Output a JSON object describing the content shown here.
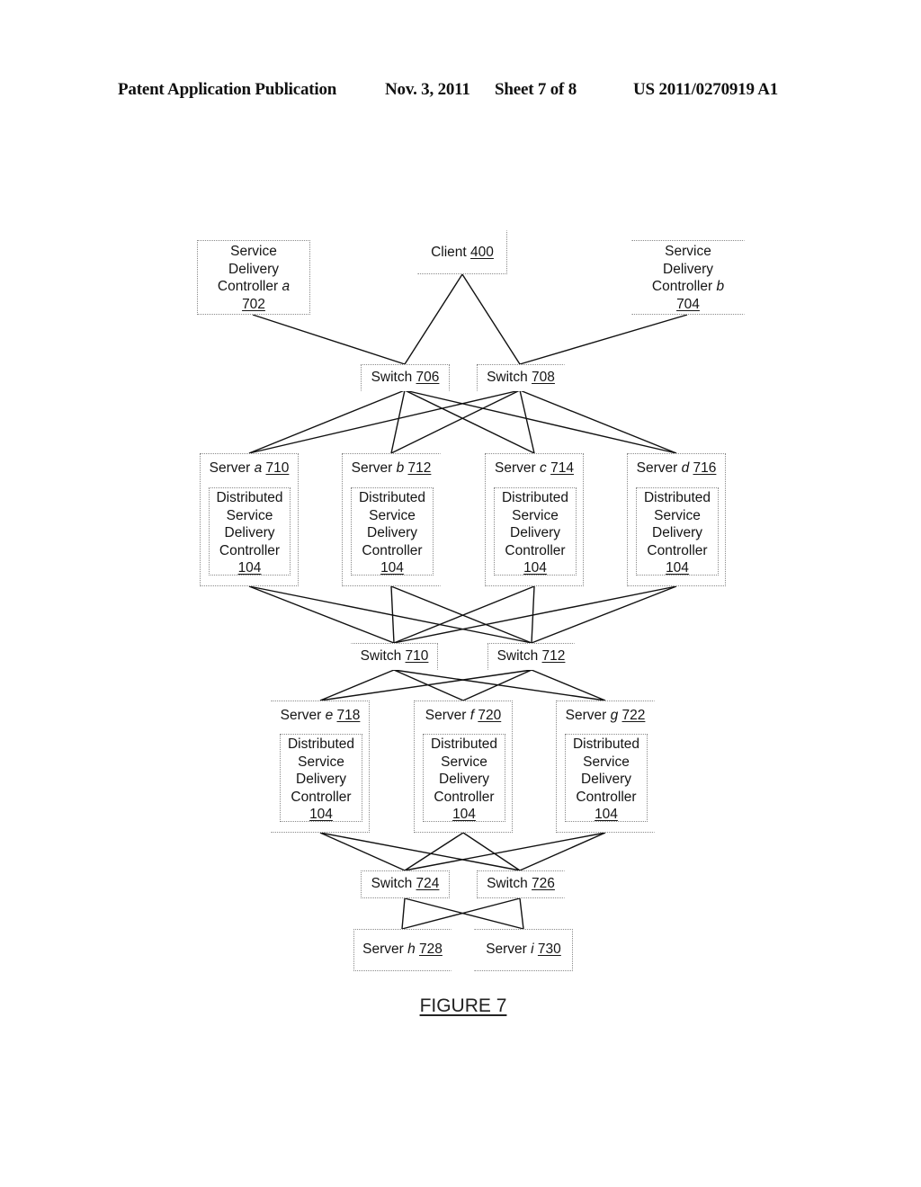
{
  "header": {
    "publication": "Patent Application Publication",
    "date": "Nov. 3, 2011",
    "sheet": "Sheet 7 of 8",
    "number": "US 2011/0270919 A1"
  },
  "figure_caption": "FIGURE 7",
  "nodes": {
    "sdc_a": {
      "l1": "Service",
      "l2": "Delivery",
      "l3": "Controller",
      "var": "a",
      "ref": "702"
    },
    "client": {
      "label": "Client",
      "ref": "400"
    },
    "sdc_b": {
      "l1": "Service",
      "l2": "Delivery",
      "l3": "Controller",
      "var": "b",
      "ref": "704"
    },
    "sw706": {
      "label": "Switch",
      "ref": "706"
    },
    "sw708": {
      "label": "Switch",
      "ref": "708"
    },
    "sw710": {
      "label": "Switch",
      "ref": "710"
    },
    "sw712": {
      "label": "Switch",
      "ref": "712"
    },
    "sw724": {
      "label": "Switch",
      "ref": "724"
    },
    "sw726": {
      "label": "Switch",
      "ref": "726"
    },
    "srv_a": {
      "label": "Server",
      "var": "a",
      "ref": "710"
    },
    "srv_b": {
      "label": "Server",
      "var": "b",
      "ref": "712"
    },
    "srv_c": {
      "label": "Server",
      "var": "c",
      "ref": "714"
    },
    "srv_d": {
      "label": "Server",
      "var": "d",
      "ref": "716"
    },
    "srv_e": {
      "label": "Server",
      "var": "e",
      "ref": "718"
    },
    "srv_f": {
      "label": "Server",
      "var": "f",
      "ref": "720"
    },
    "srv_g": {
      "label": "Server",
      "var": "g",
      "ref": "722"
    },
    "srv_h": {
      "label": "Server",
      "var": "h",
      "ref": "728"
    },
    "srv_i": {
      "label": "Server",
      "var": "i",
      "ref": "730"
    }
  },
  "dsdc": {
    "l1": "Distributed",
    "l2": "Service",
    "l3": "Delivery",
    "l4": "Controller",
    "ref": "104"
  },
  "edges": [
    [
      "sdc_a",
      "sw706"
    ],
    [
      "client",
      "sw706"
    ],
    [
      "client",
      "sw708"
    ],
    [
      "sdc_b",
      "sw708"
    ],
    [
      "sw706",
      "srv_a"
    ],
    [
      "sw706",
      "srv_b"
    ],
    [
      "sw706",
      "srv_c"
    ],
    [
      "sw706",
      "srv_d"
    ],
    [
      "sw708",
      "srv_a"
    ],
    [
      "sw708",
      "srv_b"
    ],
    [
      "sw708",
      "srv_c"
    ],
    [
      "sw708",
      "srv_d"
    ],
    [
      "srv_a",
      "sw710"
    ],
    [
      "srv_b",
      "sw710"
    ],
    [
      "srv_c",
      "sw710"
    ],
    [
      "srv_d",
      "sw710"
    ],
    [
      "srv_a",
      "sw712"
    ],
    [
      "srv_b",
      "sw712"
    ],
    [
      "srv_c",
      "sw712"
    ],
    [
      "srv_d",
      "sw712"
    ],
    [
      "sw710",
      "srv_e"
    ],
    [
      "sw710",
      "srv_f"
    ],
    [
      "sw710",
      "srv_g"
    ],
    [
      "sw712",
      "srv_e"
    ],
    [
      "sw712",
      "srv_f"
    ],
    [
      "sw712",
      "srv_g"
    ],
    [
      "srv_e",
      "sw724"
    ],
    [
      "srv_f",
      "sw724"
    ],
    [
      "srv_g",
      "sw724"
    ],
    [
      "srv_e",
      "sw726"
    ],
    [
      "srv_f",
      "sw726"
    ],
    [
      "srv_g",
      "sw726"
    ],
    [
      "sw724",
      "srv_h"
    ],
    [
      "sw724",
      "srv_i"
    ],
    [
      "sw726",
      "srv_h"
    ],
    [
      "sw726",
      "srv_i"
    ]
  ]
}
